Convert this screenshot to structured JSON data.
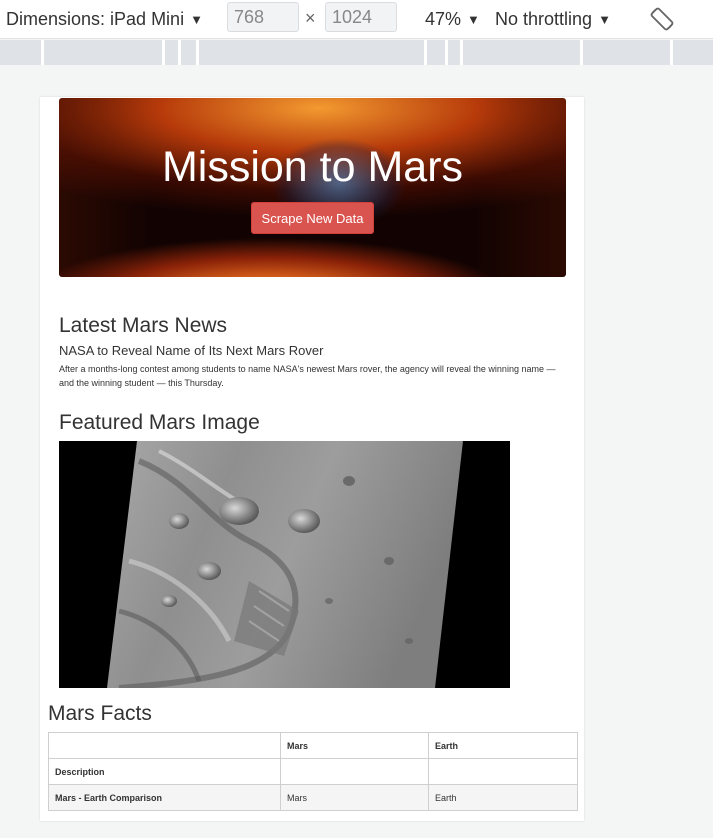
{
  "toolbar": {
    "dimensions_label": "Dimensions: iPad Mini",
    "width_value": "768",
    "height_value": "1024",
    "times": "×",
    "zoom_label": "47%",
    "throttle_label": "No throttling",
    "caret": "▼"
  },
  "page": {
    "jumbotron": {
      "title": "Mission to Mars",
      "button_label": "Scrape New Data"
    },
    "news": {
      "heading": "Latest Mars News",
      "title": "NASA to Reveal Name of Its Next Mars Rover",
      "body": "After a months-long contest among students to name NASA's newest Mars rover, the agency will reveal the winning name — and the winning student — this Thursday."
    },
    "featured": {
      "heading": "Featured Mars Image"
    },
    "facts": {
      "heading": "Mars Facts",
      "columns": [
        "",
        "Mars",
        "Earth"
      ],
      "rows": [
        [
          "Description",
          "",
          ""
        ],
        [
          "Mars - Earth Comparison",
          "Mars",
          "Earth"
        ]
      ]
    }
  }
}
